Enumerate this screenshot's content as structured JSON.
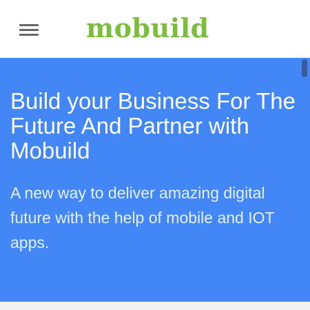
{
  "header": {
    "menu_icon": "hamburger-menu-icon",
    "logo_text": "mobuild",
    "logo_color": "#7bbd3c"
  },
  "hero": {
    "title": "Build your Business For The Future And Partner with Mobuild",
    "subtitle": "A new way to deliver amazing digital future with the help of mobile and IOT apps.",
    "background_color": "#4287f5"
  }
}
